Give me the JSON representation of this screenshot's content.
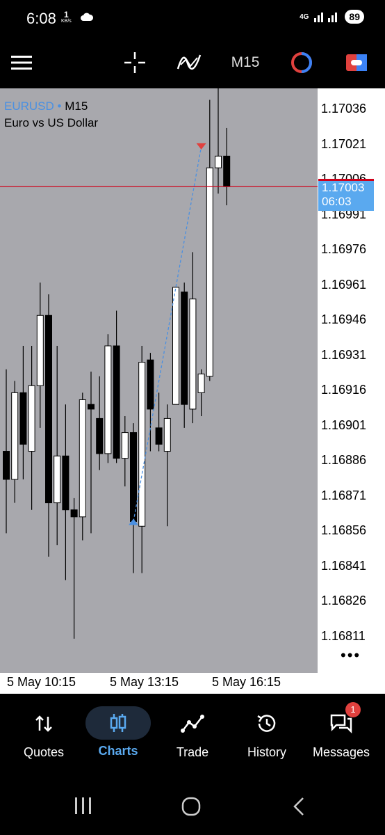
{
  "status_bar": {
    "time": "6:08",
    "net_speed_value": "1",
    "net_speed_unit": "KB/s",
    "network": "4G",
    "battery": "89"
  },
  "toolbar": {
    "timeframe": "M15"
  },
  "chart": {
    "symbol": "EURUSD",
    "symbol_marker": "•",
    "timeframe": "M15",
    "description": "Euro vs US Dollar",
    "bid_line_color": "#d0021b",
    "current_price": "1.17003",
    "countdown": "06:03",
    "more_label": "•••"
  },
  "chart_data": {
    "type": "candlestick",
    "price_ticks": [
      "1.17036",
      "1.17021",
      "1.17006",
      "1.16991",
      "1.16976",
      "1.16961",
      "1.16946",
      "1.16931",
      "1.16916",
      "1.16901",
      "1.16886",
      "1.16871",
      "1.16856",
      "1.16841",
      "1.16826",
      "1.16811"
    ],
    "time_ticks": [
      "5 May 10:15",
      "5 May 13:15",
      "5 May 16:15"
    ],
    "ylim": [
      1.168,
      1.1704
    ],
    "candles": [
      {
        "o": 1.1689,
        "h": 1.16925,
        "l": 1.16855,
        "c": 1.16878
      },
      {
        "o": 1.16878,
        "h": 1.1692,
        "l": 1.16868,
        "c": 1.16915
      },
      {
        "o": 1.16915,
        "h": 1.16935,
        "l": 1.16878,
        "c": 1.16893
      },
      {
        "o": 1.1689,
        "h": 1.16935,
        "l": 1.16865,
        "c": 1.16918
      },
      {
        "o": 1.16918,
        "h": 1.16962,
        "l": 1.169,
        "c": 1.16948
      },
      {
        "o": 1.16948,
        "h": 1.16957,
        "l": 1.16845,
        "c": 1.16868
      },
      {
        "o": 1.16868,
        "h": 1.16935,
        "l": 1.1685,
        "c": 1.16888
      },
      {
        "o": 1.16888,
        "h": 1.1691,
        "l": 1.16835,
        "c": 1.16865
      },
      {
        "o": 1.16865,
        "h": 1.1687,
        "l": 1.1681,
        "c": 1.16862
      },
      {
        "o": 1.16862,
        "h": 1.16915,
        "l": 1.16852,
        "c": 1.16912
      },
      {
        "o": 1.1691,
        "h": 1.16924,
        "l": 1.16855,
        "c": 1.16908
      },
      {
        "o": 1.16904,
        "h": 1.16922,
        "l": 1.16882,
        "c": 1.16889
      },
      {
        "o": 1.16889,
        "h": 1.1694,
        "l": 1.16885,
        "c": 1.16935
      },
      {
        "o": 1.16935,
        "h": 1.1695,
        "l": 1.16885,
        "c": 1.16887
      },
      {
        "o": 1.16887,
        "h": 1.16905,
        "l": 1.16875,
        "c": 1.16898
      },
      {
        "o": 1.16898,
        "h": 1.16902,
        "l": 1.16838,
        "c": 1.1686
      },
      {
        "o": 1.16858,
        "h": 1.16935,
        "l": 1.16838,
        "c": 1.16928
      },
      {
        "o": 1.16929,
        "h": 1.16932,
        "l": 1.1689,
        "c": 1.16908
      },
      {
        "o": 1.169,
        "h": 1.16915,
        "l": 1.1689,
        "c": 1.16893
      },
      {
        "o": 1.1689,
        "h": 1.1691,
        "l": 1.16858,
        "c": 1.16904
      },
      {
        "o": 1.1691,
        "h": 1.1696,
        "l": 1.1691,
        "c": 1.1696
      },
      {
        "o": 1.16958,
        "h": 1.16962,
        "l": 1.169,
        "c": 1.1691
      },
      {
        "o": 1.16908,
        "h": 1.16975,
        "l": 1.16902,
        "c": 1.16955
      },
      {
        "o": 1.16915,
        "h": 1.16925,
        "l": 1.16905,
        "c": 1.16923
      },
      {
        "o": 1.16922,
        "h": 1.1704,
        "l": 1.1692,
        "c": 1.17011
      },
      {
        "o": 1.17011,
        "h": 1.17045,
        "l": 1.17,
        "c": 1.17016
      },
      {
        "o": 1.17016,
        "h": 1.17028,
        "l": 1.16995,
        "c": 1.17003
      }
    ],
    "bid_price": 1.17003,
    "trade_line": {
      "from_index": 15,
      "from_price": 1.1686,
      "to_index": 23,
      "to_price": 1.1702
    },
    "colors": {
      "bull_fill": "#ffffff",
      "bear_fill": "#000000",
      "wick": "#000000",
      "background": "#a8a8ad",
      "trade_line": "#4a90e2",
      "sell_arrow": "#e0413e",
      "buy_arrow": "#4a90e2"
    }
  },
  "bottom_nav": {
    "items": [
      {
        "label": "Quotes",
        "icon": "quotes-arrows-icon"
      },
      {
        "label": "Charts",
        "icon": "candles-icon"
      },
      {
        "label": "Trade",
        "icon": "trade-line-icon"
      },
      {
        "label": "History",
        "icon": "history-clock-icon"
      },
      {
        "label": "Messages",
        "icon": "messages-icon"
      }
    ],
    "messages_badge": "1",
    "active_color": "#5aa9ef"
  }
}
